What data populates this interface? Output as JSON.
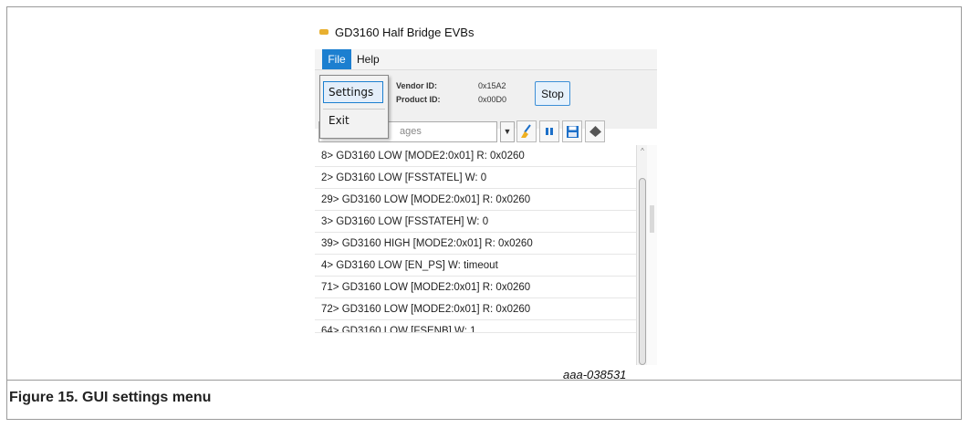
{
  "figure": {
    "caption": "Figure 15.  GUI settings menu",
    "id": "aaa-038531"
  },
  "app": {
    "title": "GD3160 Half Bridge EVBs",
    "menu": {
      "file": "File",
      "help": "Help"
    },
    "file_menu": {
      "settings": "Settings",
      "exit": "Exit"
    },
    "device": {
      "vendor_label": "Vendor ID:",
      "vendor_value": "0x15A2",
      "product_label": "Product ID:",
      "product_value": "0x00D0"
    },
    "stop_label": "Stop",
    "filter_placeholder_visible": "ages",
    "log_rows": [
      "8> GD3160 LOW [MODE2:0x01] R: 0x0260",
      "2> GD3160 LOW [FSSTATEL] W: 0",
      "29> GD3160 LOW [MODE2:0x01] R: 0x0260",
      "3> GD3160 LOW [FSSTATEH] W: 0",
      "39> GD3160 HIGH [MODE2:0x01] R: 0x0260",
      "4> GD3160 LOW [EN_PS] W: timeout",
      "71> GD3160 LOW [MODE2:0x01] R: 0x0260",
      "72> GD3160 LOW [MODE2:0x01] R: 0x0260",
      "64> GD3160 LOW [FSENB] W: 1"
    ],
    "icons": {
      "clear": "broom-icon",
      "pause": "pause-icon",
      "save": "floppy-disk-icon",
      "erase": "eraser-icon"
    },
    "colors": {
      "menu_highlight": "#1c7fd0",
      "pause_icon": "#1c6fc8"
    }
  }
}
